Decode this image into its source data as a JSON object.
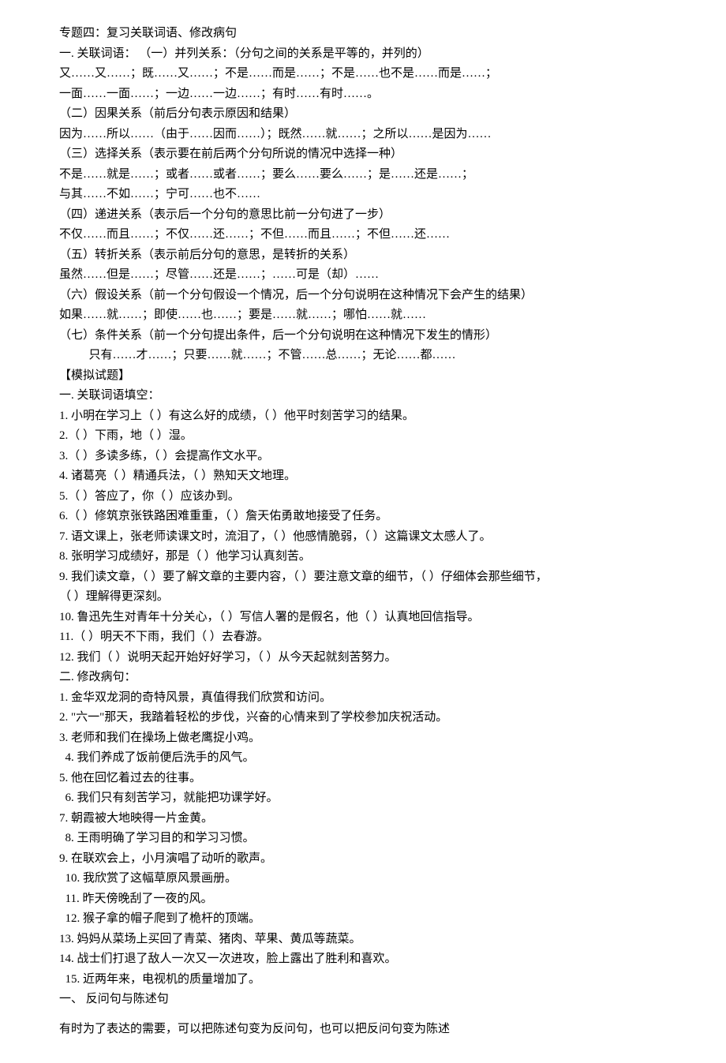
{
  "lines": [
    {
      "text": "专题四：复习关联词语、修改病句",
      "cls": ""
    },
    {
      "text": "一. 关联词语：  （一）并列关系：（分句之间的关系是平等的，并列的）",
      "cls": ""
    },
    {
      "text": "又……又……；既……又……；不是……而是……；不是……也不是……而是……；",
      "cls": ""
    },
    {
      "text": "一面……一面……；一边……一边……；有时……有时……。",
      "cls": ""
    },
    {
      "text": "（二）因果关系（前后分句表示原因和结果）",
      "cls": ""
    },
    {
      "text": "因为……所以……（由于……因而……）；既然……就……；之所以……是因为……",
      "cls": ""
    },
    {
      "text": "（三）选择关系（表示要在前后两个分句所说的情况中选择一种）",
      "cls": ""
    },
    {
      "text": "不是……就是……；或者……或者……；要么……要么……；是……还是……；",
      "cls": ""
    },
    {
      "text": "与其……不如……；宁可……也不……",
      "cls": ""
    },
    {
      "text": "（四）递进关系（表示后一个分句的意思比前一分句进了一步）",
      "cls": ""
    },
    {
      "text": "不仅……而且……；不仅……还……；不但……而且……；不但……还……",
      "cls": ""
    },
    {
      "text": "（五）转折关系（表示前后分句的意思，是转折的关系）",
      "cls": ""
    },
    {
      "text": "虽然……但是……；尽管……还是……；……可是（却）……",
      "cls": ""
    },
    {
      "text": "（六）假设关系（前一个分句假设一个情况，后一个分句说明在这种情况下会产生的结果）",
      "cls": ""
    },
    {
      "text": "如果……就……；即使……也……；要是……就……；哪怕……就……",
      "cls": ""
    },
    {
      "text": "（七）条件关系（前一个分句提出条件，后一个分句说明在这种情况下发生的情形）",
      "cls": ""
    },
    {
      "text": "只有……才……；只要……就……；不管……总……；无论……都……",
      "cls": "indent1"
    },
    {
      "text": "【模拟试题】",
      "cls": ""
    },
    {
      "text": "一. 关联词语填空：",
      "cls": ""
    },
    {
      "text": "1. 小明在学习上（     ）有这么好的成绩，（     ）他平时刻苦学习的结果。",
      "cls": ""
    },
    {
      "text": "2.（     ）下雨，地（     ）湿。",
      "cls": ""
    },
    {
      "text": "3.（     ）多读多练，（     ）会提高作文水平。",
      "cls": ""
    },
    {
      "text": "4. 诸葛亮（     ）精通兵法，（     ）熟知天文地理。",
      "cls": ""
    },
    {
      "text": "5.（     ）答应了，你（     ）应该办到。",
      "cls": ""
    },
    {
      "text": "6.（     ）修筑京张铁路困难重重，（     ）詹天佑勇敢地接受了任务。",
      "cls": ""
    },
    {
      "text": "7. 语文课上，张老师读课文时，流泪了，（     ）他感情脆弱，（     ）这篇课文太感人了。",
      "cls": ""
    },
    {
      "text": "8. 张明学习成绩好，那是（     ）他学习认真刻苦。",
      "cls": ""
    },
    {
      "text": "9. 我们读文章，（     ）要了解文章的主要内容，（     ）要注意文章的细节，（     ）仔细体会那些细节，",
      "cls": ""
    },
    {
      "text": "（     ）理解得更深刻。",
      "cls": ""
    },
    {
      "text": "10. 鲁迅先生对青年十分关心，（     ）写信人署的是假名，他（     ）认真地回信指导。",
      "cls": ""
    },
    {
      "text": "11.（     ）明天不下雨，我们（     ）去春游。",
      "cls": ""
    },
    {
      "text": "12. 我们（     ）说明天起开始好好学习，（     ）从今天起就刻苦努力。",
      "cls": ""
    },
    {
      "text": "二. 修改病句：",
      "cls": ""
    },
    {
      "text": "1. 金华双龙洞的奇特风景，真值得我们欣赏和访问。",
      "cls": ""
    },
    {
      "text": "2. \"六一\"那天，我踏着轻松的步伐，兴奋的心情来到了学校参加庆祝活动。",
      "cls": ""
    },
    {
      "text": "3. 老师和我们在操场上做老鹰捉小鸡。",
      "cls": ""
    },
    {
      "text": "4. 我们养成了饭前便后洗手的风气。",
      "cls": "indent-small"
    },
    {
      "text": "5. 他在回忆着过去的往事。",
      "cls": ""
    },
    {
      "text": "6. 我们只有刻苦学习，就能把功课学好。",
      "cls": "indent-small"
    },
    {
      "text": "7. 朝霞被大地映得一片金黄。",
      "cls": ""
    },
    {
      "text": "8. 王雨明确了学习目的和学习习惯。",
      "cls": "indent-small"
    },
    {
      "text": "9. 在联欢会上，小月演唱了动听的歌声。",
      "cls": ""
    },
    {
      "text": "10. 我欣赏了这幅草原风景画册。",
      "cls": "indent-small"
    },
    {
      "text": "11. 昨天傍晚刮了一夜的风。",
      "cls": "indent-small"
    },
    {
      "text": "12. 猴子拿的帽子爬到了桅杆的顶端。",
      "cls": "indent-small"
    },
    {
      "text": "13. 妈妈从菜场上买回了青菜、猪肉、苹果、黄瓜等蔬菜。",
      "cls": ""
    },
    {
      "text": "14. 战士们打退了敌人一次又一次进攻，脸上露出了胜利和喜欢。",
      "cls": ""
    },
    {
      "text": "15. 近两年来，电视机的质量增加了。",
      "cls": "indent-small"
    },
    {
      "text": "一、  反问句与陈述句",
      "cls": ""
    },
    {
      "text": "有时为了表达的需要，可以把陈述句变为反问句，也可以把反问句变为陈述",
      "cls": "top-gap"
    }
  ]
}
